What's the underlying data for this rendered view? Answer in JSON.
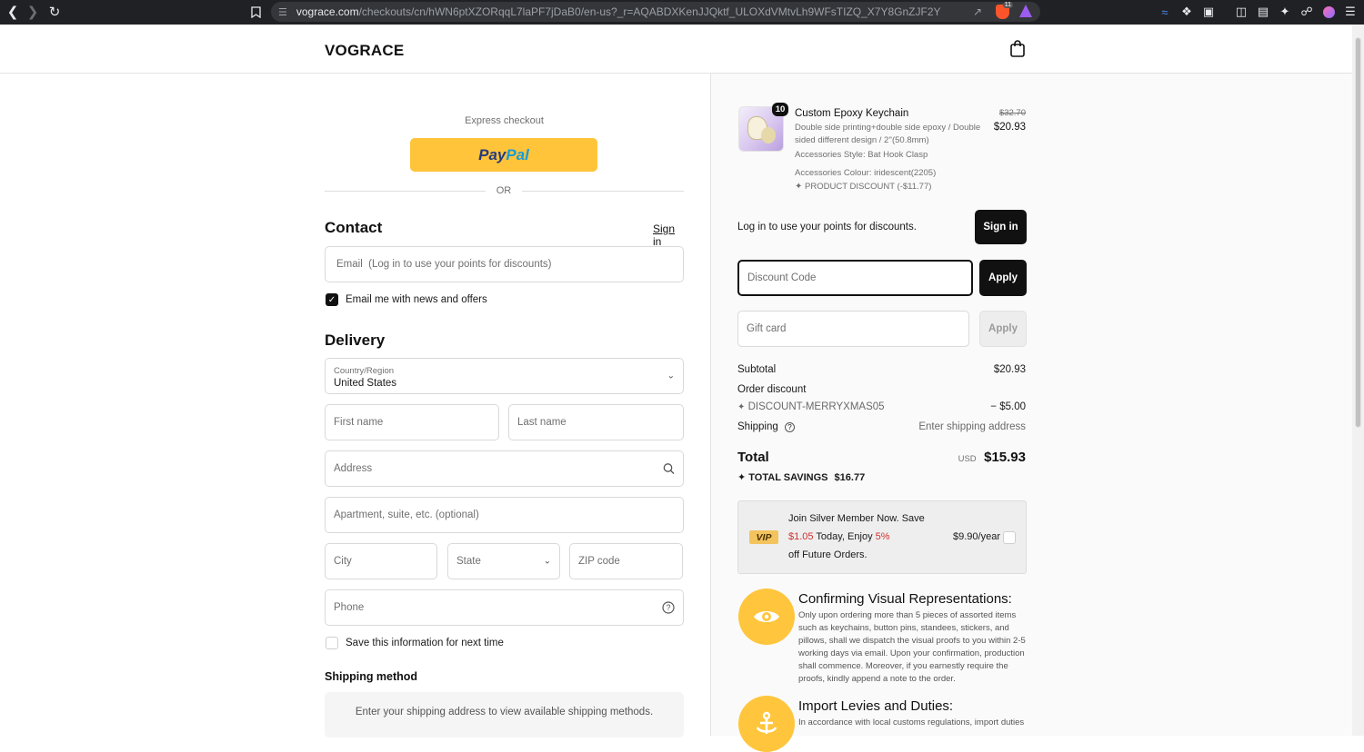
{
  "browser": {
    "url_host": "vograce.com",
    "url_path": "/checkouts/cn/hWN6ptXZORqqL7laPF7jDaB0/en-us?_r=AQABDXKenJJQktf_ULOXdVMtvLh9WFsTIZQ_X7Y8GnZJF2Y",
    "brave_badge": "11"
  },
  "header": {
    "logo": "VOGRACE",
    "cart_icon": "shopping-bag-icon"
  },
  "express": {
    "label": "Express checkout",
    "paypal_1": "Pay",
    "paypal_2": "Pal",
    "or": "OR"
  },
  "contact": {
    "title": "Contact",
    "sign_in": "Sign in",
    "email_placeholder": "Email  (Log in to use your points for discounts)",
    "newsletter_label": "Email me with news and offers",
    "newsletter_checked": true
  },
  "delivery": {
    "title": "Delivery",
    "country_label": "Country/Region",
    "country_value": "United States",
    "first_name": "First name",
    "last_name": "Last name",
    "address": "Address",
    "apartment": "Apartment, suite, etc. (optional)",
    "city": "City",
    "state": "State",
    "zip": "ZIP code",
    "phone": "Phone",
    "save_info_label": "Save this information for next time",
    "save_info_checked": false
  },
  "shipping": {
    "title": "Shipping method",
    "message": "Enter your shipping address to view available shipping methods."
  },
  "cart": {
    "quantity": "10",
    "product_title": "Custom Epoxy Keychain",
    "product_desc": "Double side printing+double side epoxy / Double sided different design / 2''(50.8mm)",
    "product_style": "Accessories Style: Bat Hook Clasp",
    "product_colour": "Accessories Colour: iridescent(2205)",
    "product_discount": "PRODUCT DISCOUNT (-$11.77)",
    "old_price": "$32.70",
    "new_price": "$20.93"
  },
  "points": {
    "text": "Log in to use your points for discounts.",
    "button": "Sign in"
  },
  "discount": {
    "placeholder": "Discount Code",
    "button": "Apply"
  },
  "gift": {
    "placeholder": "Gift card",
    "button": "Apply"
  },
  "summary": {
    "subtotal_label": "Subtotal",
    "subtotal_value": "$20.93",
    "order_discount_label": "Order discount",
    "discount_code": "DISCOUNT-MERRYXMAS05",
    "discount_value": "− $5.00",
    "shipping_label": "Shipping",
    "shipping_value": "Enter shipping address",
    "total_label": "Total",
    "currency": "USD",
    "total_value": "$15.93",
    "savings_label": "TOTAL SAVINGS",
    "savings_value": "$16.77"
  },
  "vip": {
    "badge": "VIP",
    "line1": "Join Silver Member Now. Save",
    "save_amount": "$1.05",
    "today": "Today,",
    "enjoy": "Enjoy",
    "percent": "5%",
    "line3": "off Future Orders.",
    "price": "$9.90/year"
  },
  "info": [
    {
      "title": "Confirming Visual Representations:",
      "body": "Only upon ordering more than 5 pieces of assorted items such as keychains, button pins, standees, stickers, and pillows, shall we dispatch the visual proofs to you within 2-5 working days via email. Upon your confirmation, production shall commence. Moreover, if you earnestly require the proofs, kindly append a note to the order."
    },
    {
      "title": "Import Levies and Duties:",
      "body": "In accordance with local customs regulations, import duties"
    }
  ]
}
